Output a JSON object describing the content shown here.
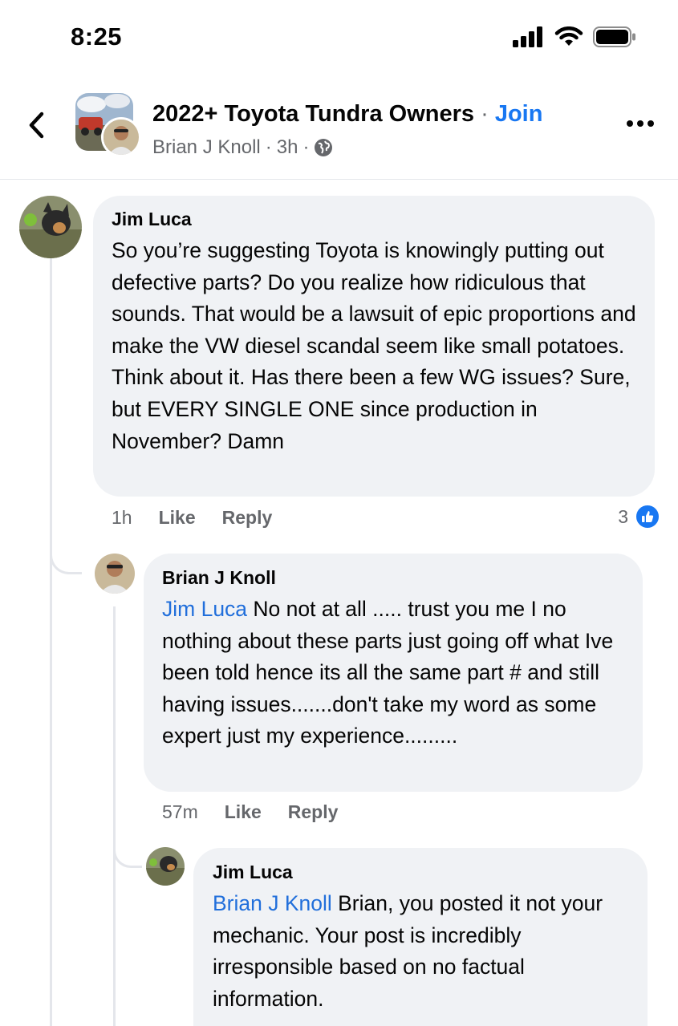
{
  "status_bar": {
    "time": "8:25"
  },
  "header": {
    "group_name": "2022+ Toyota Tundra Owners",
    "separator": "·",
    "join_label": "Join",
    "author": "Brian J Knoll",
    "time": "3h"
  },
  "comments": [
    {
      "name": "Jim Luca",
      "mention": "",
      "text": "So you’re suggesting Toyota is knowingly putting out defective parts? Do you realize how ridiculous that sounds. That would be a lawsuit of epic proportions and make the VW diesel scandal seem like small potatoes. Think about it. Has there been a few WG issues? Sure, but EVERY SINGLE ONE since production in November?  Damn",
      "time": "1h",
      "like_label": "Like",
      "reply_label": "Reply",
      "reaction_count": "3"
    },
    {
      "name": "Brian J Knoll",
      "mention": "Jim Luca",
      "text": " No not at all ..... trust you me I no nothing about these parts just going off what Ive been told hence its all the same part # and still having issues.......don't take my word as some expert just my experience.........",
      "time": "57m",
      "like_label": "Like",
      "reply_label": "Reply"
    },
    {
      "name": "Jim Luca",
      "mention": "Brian J Knoll",
      "text": " Brian, you posted it not your mechanic. Your post is incredibly irresponsible based on no factual information."
    }
  ],
  "colors": {
    "accent": "#1877f2",
    "mention": "#216fdb",
    "bubble": "#f0f2f5",
    "secondary_text": "#65676b"
  }
}
